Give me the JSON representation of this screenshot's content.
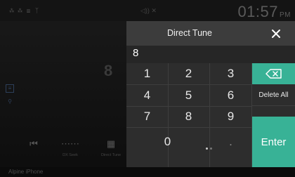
{
  "status": {
    "time": "01:57",
    "ampm": "PM"
  },
  "background": {
    "partial_freq": "8",
    "controls": [
      {
        "icon": "skip-back-icon",
        "glyph": "⏮",
        "label": ""
      },
      {
        "icon": "seek-icon",
        "glyph": "⋯⋯",
        "label": "DX Seek"
      },
      {
        "icon": "keypad-icon",
        "glyph": "▦",
        "label": "Direct Tune"
      }
    ],
    "source_name": "Alpine iPhone"
  },
  "dialog": {
    "title": "Direct Tune",
    "close_glyph": "✕",
    "entered_value": "8",
    "keys": [
      "1",
      "2",
      "3",
      "4",
      "5",
      "6",
      "7",
      "8",
      "9",
      "0",
      "."
    ],
    "delete_all_label": "Delete All",
    "enter_label": "Enter"
  },
  "colors": {
    "accent": "#38b296",
    "dialog_bg": "#2d2d2d",
    "header_bg": "#3c3c3c"
  }
}
